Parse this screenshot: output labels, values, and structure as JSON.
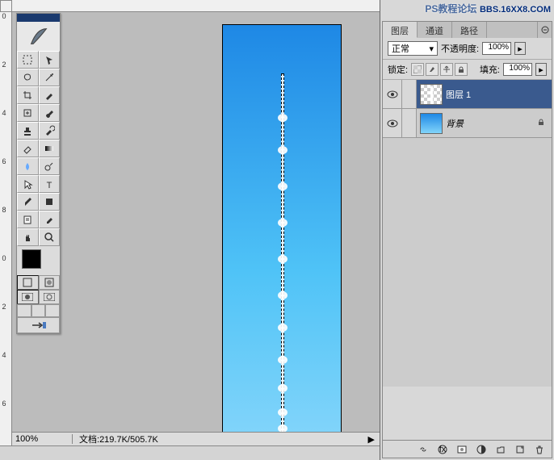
{
  "watermark": {
    "cn": "PS教程论坛",
    "url": "BBS.16XX8.COM"
  },
  "ruler_v_marks": [
    "0",
    "2",
    "4",
    "6",
    "8",
    "0",
    "2",
    "4",
    "6"
  ],
  "tools": [
    "marquee",
    "move",
    "lasso",
    "wand",
    "crop",
    "slice",
    "healing",
    "brush",
    "stamp",
    "history-brush",
    "eraser",
    "gradient",
    "blur",
    "dodge",
    "path-select",
    "type",
    "pen",
    "shape",
    "notes",
    "eyedropper",
    "hand",
    "zoom"
  ],
  "colors": {
    "fg": "#000000",
    "bg": "#ffffff"
  },
  "status": {
    "zoom": "100%",
    "doc_label": "文档:",
    "doc_size": "219.7K/505.7K"
  },
  "panel": {
    "tabs": [
      "图层",
      "通道",
      "路径"
    ],
    "active_tab": 0,
    "blend_mode": "正常",
    "opacity_label": "不透明度:",
    "opacity_value": "100%",
    "lock_label": "锁定:",
    "fill_label": "填充:",
    "fill_value": "100%",
    "layers": [
      {
        "name": "图层 1",
        "active": true,
        "thumb": "checker",
        "locked": false
      },
      {
        "name": "背景",
        "active": false,
        "thumb": "gradient",
        "locked": true
      }
    ],
    "footer_icons": [
      "link",
      "fx",
      "mask",
      "adjust",
      "group",
      "new",
      "trash"
    ]
  },
  "clouds": [
    110,
    150,
    195,
    240,
    285,
    330,
    370,
    410,
    445,
    475,
    495
  ]
}
